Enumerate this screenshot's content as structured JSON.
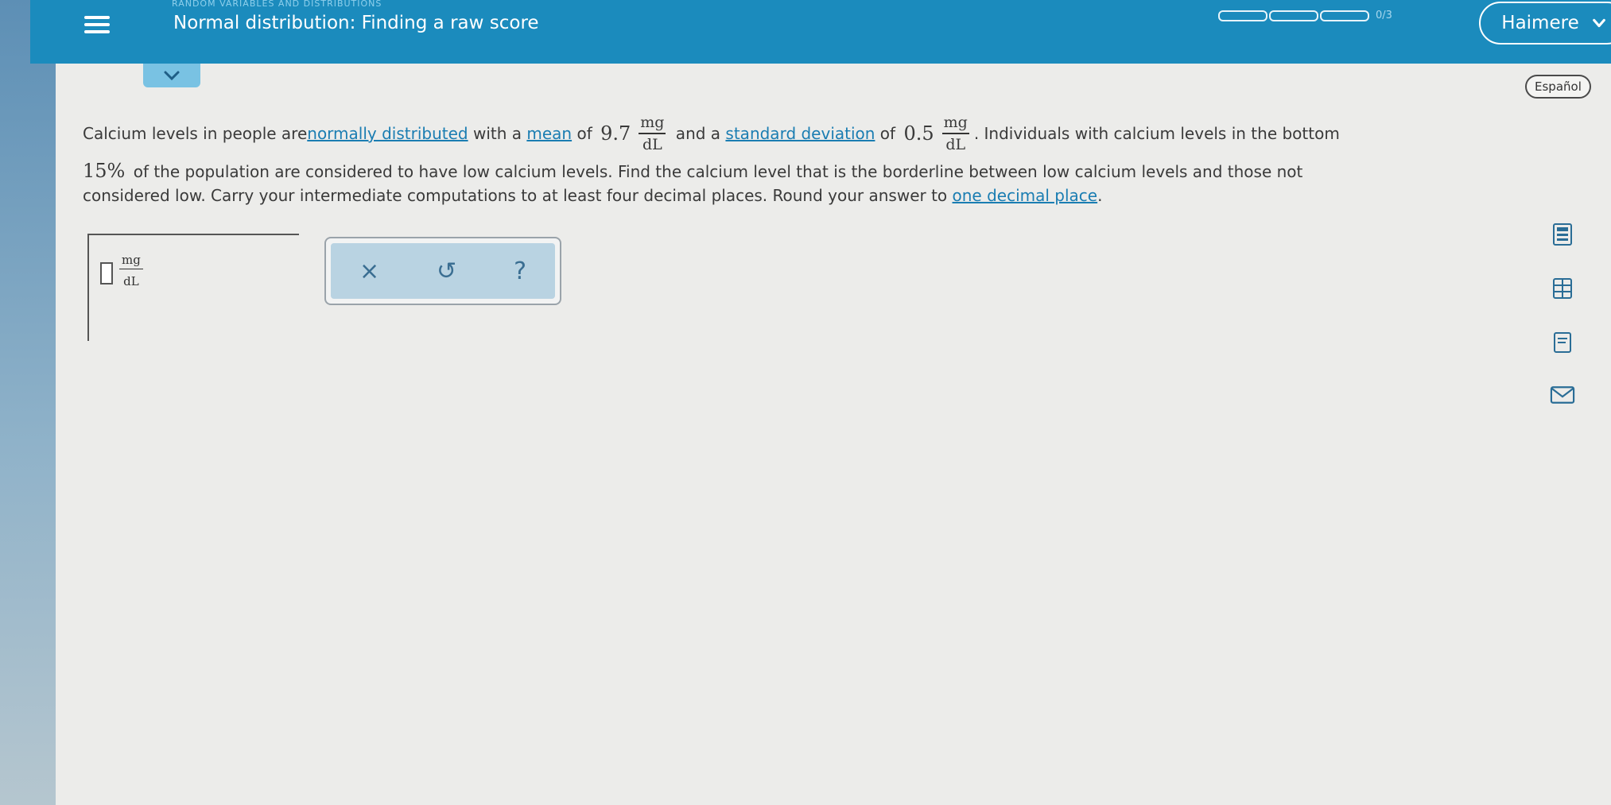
{
  "topbar": {
    "module_title": "RANDOM VARIABLES AND DISTRIBUTIONS",
    "topic_title": "Normal distribution: Finding a raw score",
    "progress_text": "0/3",
    "progress_value": 0,
    "user_label": "Haimere",
    "menu_icon": "hamburger-icon"
  },
  "language_button": "Español",
  "problem": {
    "p1": "Calcium levels in people are ",
    "link_normal": "normally distributed",
    "p2": " with a ",
    "link_mean": "mean",
    "p3": " of ",
    "mean_value": "9.7",
    "unit_num": "mg",
    "unit_den": "dL",
    "p4": " and a ",
    "link_sd": "standard deviation",
    "p5": " of ",
    "sd_value": "0.5",
    "p6": ". Individuals with calcium levels in the bottom",
    "percent": "15%",
    "p7": " of the population are considered to have low calcium levels. Find the calcium level that is the borderline between low calcium levels and those not",
    "p8": "considered low. Carry your intermediate computations to at least four decimal places. Round your answer to ",
    "link_decimal": "one decimal place",
    "p9": "."
  },
  "answer": {
    "unit_num": "mg",
    "unit_den": "dL",
    "value": ""
  },
  "tools": {
    "clear": "×",
    "undo": "↺",
    "help": "?"
  },
  "side_icons": [
    "calculator-icon",
    "data-table-icon",
    "book-icon",
    "mail-icon"
  ],
  "colors": {
    "topbar": "#1b8bbd",
    "link": "#1a7db2",
    "tools_fill": "#b9d3e2"
  }
}
